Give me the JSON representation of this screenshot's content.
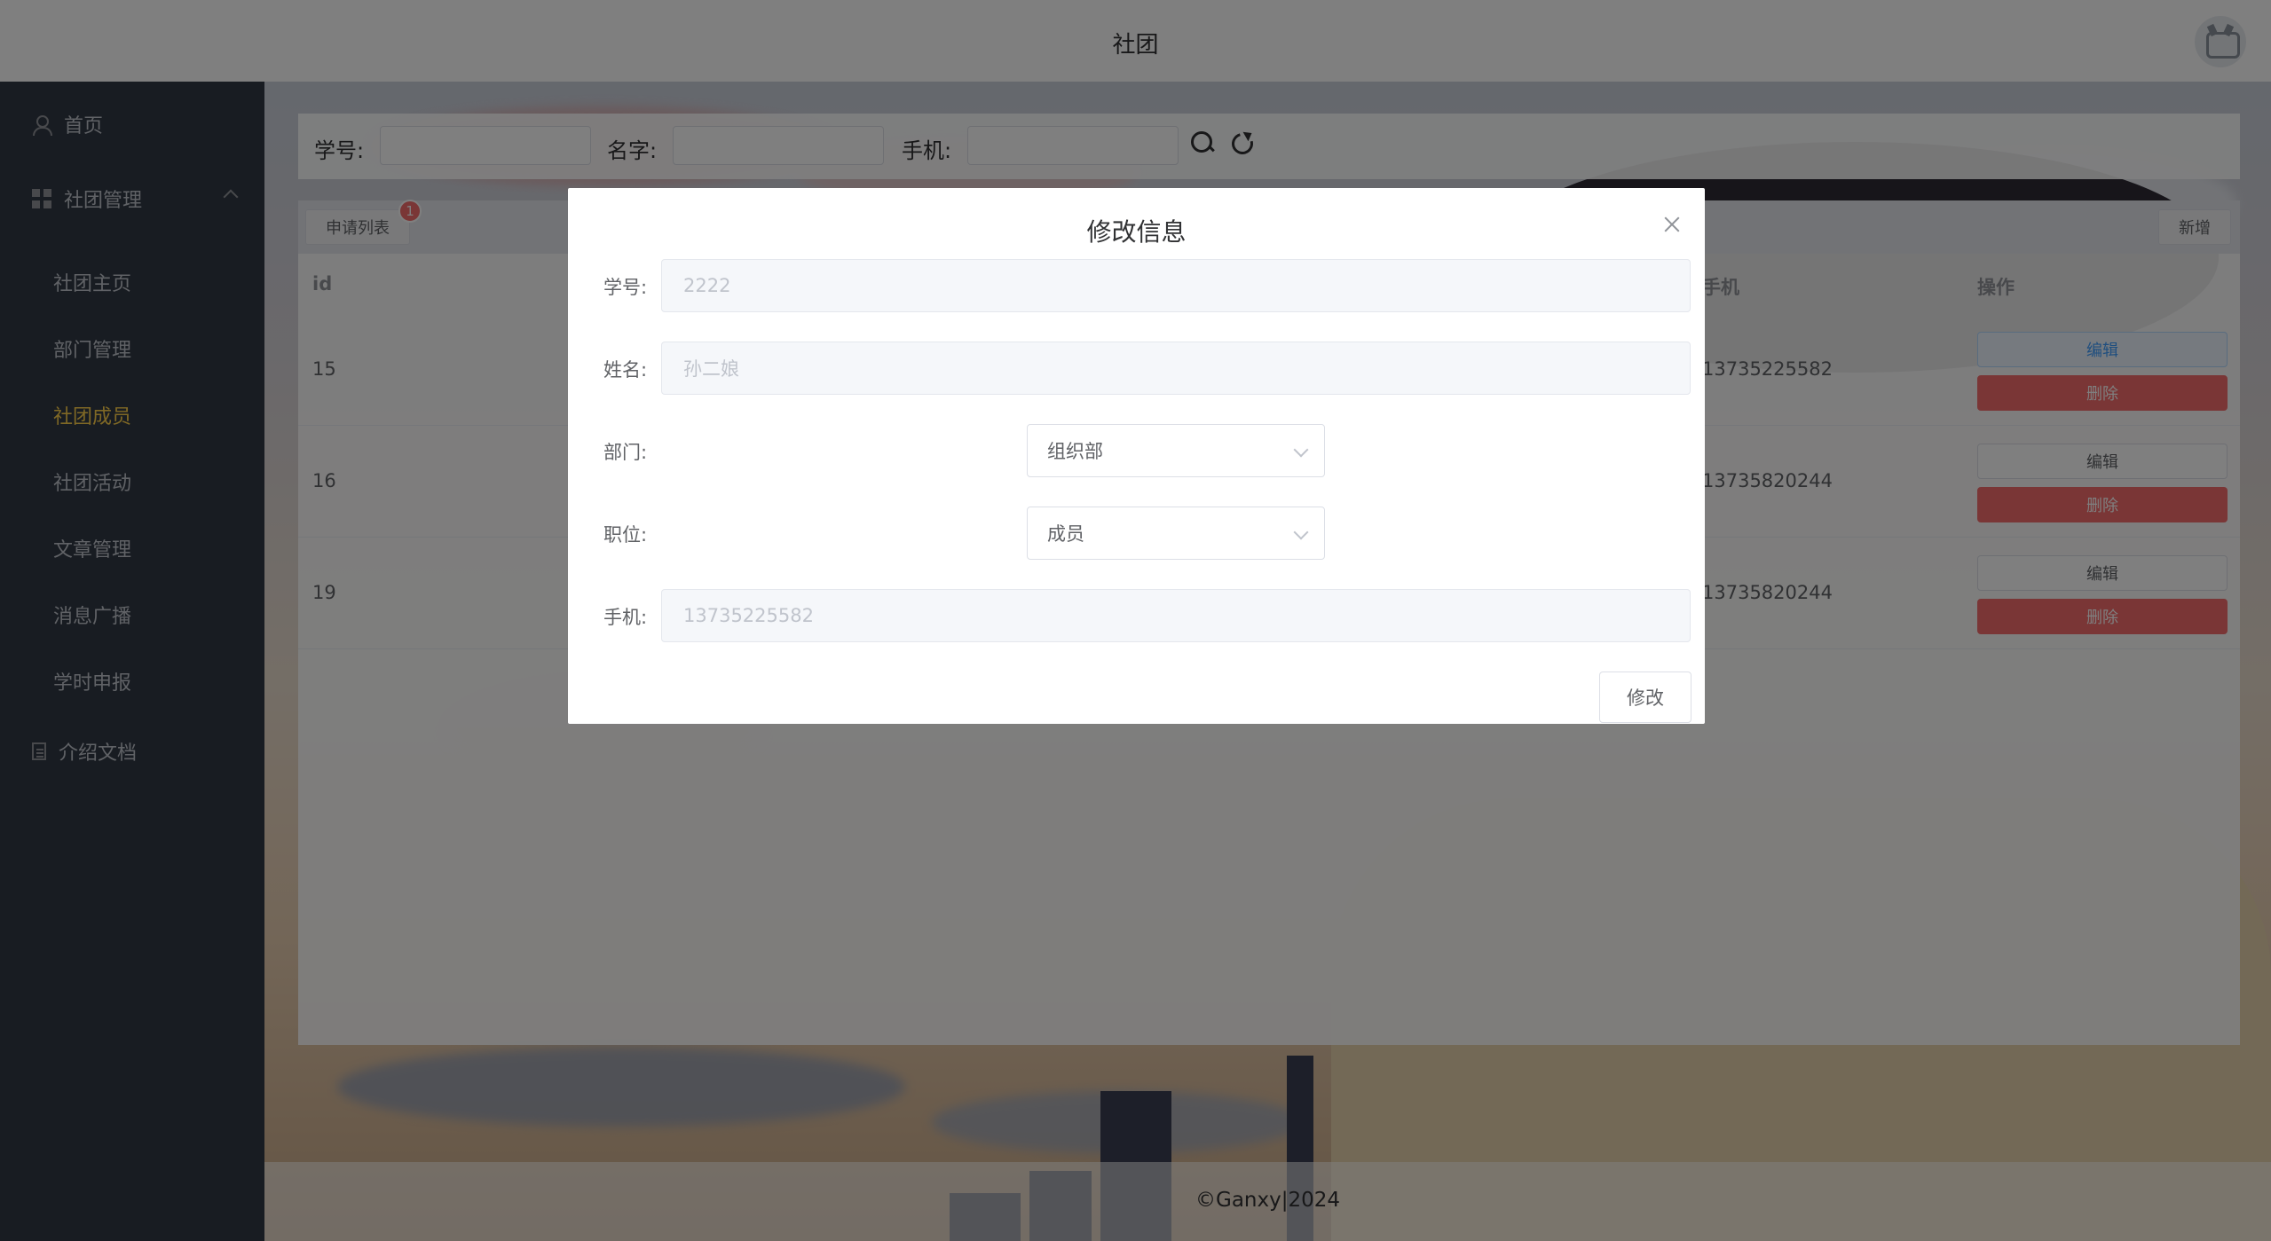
{
  "header": {
    "title": "社团"
  },
  "sidebar": {
    "home": "首页",
    "club_mgmt": "社团管理",
    "sub_items": [
      "社团主页",
      "部门管理",
      "社团成员",
      "社团活动",
      "文章管理",
      "消息广播",
      "学时申报"
    ],
    "active_index": 2,
    "intro_docs": "介绍文档"
  },
  "search": {
    "student_no_label": "学号:",
    "name_label": "名字:",
    "phone_label": "手机:"
  },
  "table": {
    "apply_list_label": "申请列表",
    "apply_badge": "1",
    "add_label": "新增",
    "columns": {
      "id": "id",
      "phone": "手机",
      "ops": "操作"
    },
    "rows": [
      {
        "id": "15",
        "phone": "13735225582"
      },
      {
        "id": "16",
        "phone": "13735820244"
      },
      {
        "id": "19",
        "phone": "13735820244"
      }
    ],
    "edit_label": "编辑",
    "delete_label": "删除"
  },
  "dialog": {
    "title": "修改信息",
    "student_no": {
      "label": "学号:",
      "value": "2222"
    },
    "name": {
      "label": "姓名:",
      "value": "孙二娘"
    },
    "department": {
      "label": "部门:",
      "value": "组织部"
    },
    "position": {
      "label": "职位:",
      "value": "成员"
    },
    "phone": {
      "label": "手机:",
      "value": "13735225582"
    },
    "submit_label": "修改"
  },
  "footer": {
    "text": "©Ganxy|2024"
  },
  "colors": {
    "accent_active": "#ffd04b",
    "danger": "#f56c6c",
    "sidebar_bg": "#303944"
  }
}
